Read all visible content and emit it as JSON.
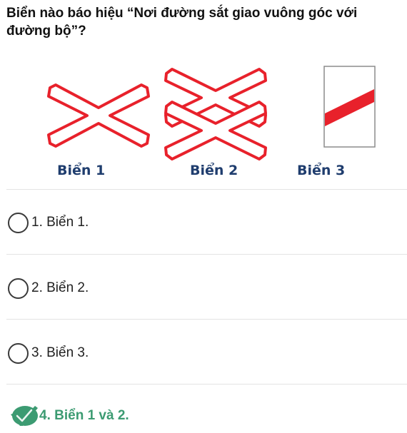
{
  "question": "Biển nào báo hiệu “Nơi đường sắt giao vuông góc với đường bộ”?",
  "signs": [
    {
      "caption": "Biển 1"
    },
    {
      "caption": "Biển 2"
    },
    {
      "caption": "Biển 3"
    }
  ],
  "options": [
    {
      "label": "1. Biển 1.",
      "selected": false,
      "correct": false
    },
    {
      "label": "2. Biển 2.",
      "selected": false,
      "correct": false
    },
    {
      "label": "3. Biển 3.",
      "selected": false,
      "correct": false
    },
    {
      "label": "4. Biển 1 và 2.",
      "selected": true,
      "correct": true
    }
  ],
  "colors": {
    "sign_red": "#e8212b",
    "correct_green": "#3c9b72",
    "caption_blue": "#1f3d6e"
  },
  "icons": {
    "radio": "radio-empty-icon",
    "correct": "checkmark-icon"
  }
}
